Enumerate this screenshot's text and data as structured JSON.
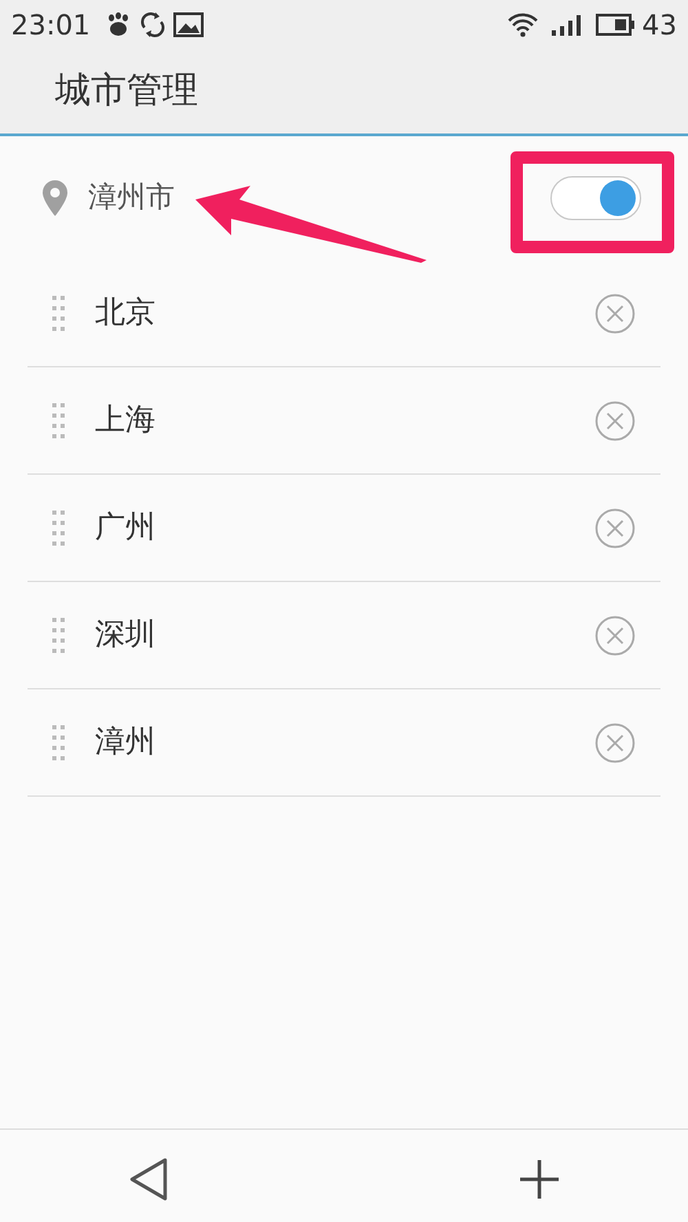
{
  "status_bar": {
    "time": "23:01",
    "battery": "43"
  },
  "title": "城市管理",
  "location": {
    "city": "漳州市",
    "auto_locate": true
  },
  "cities": [
    {
      "name": "北京"
    },
    {
      "name": "上海"
    },
    {
      "name": "广州"
    },
    {
      "name": "深圳"
    },
    {
      "name": "漳州"
    }
  ]
}
